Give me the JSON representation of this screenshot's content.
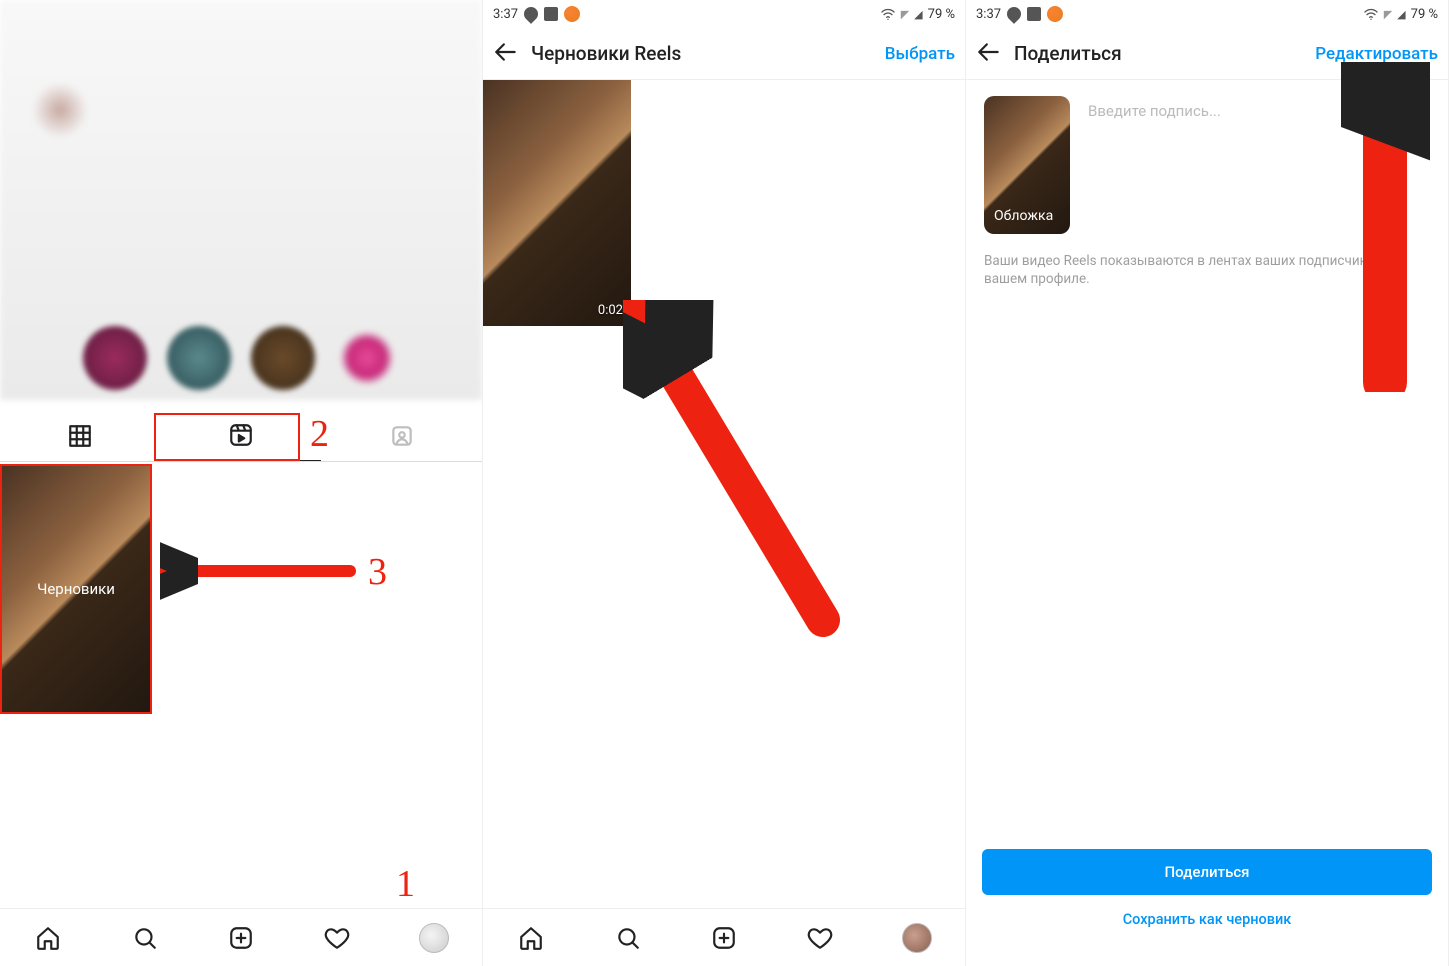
{
  "pane1": {
    "drafts_label": "Черновики",
    "annotations": {
      "num1": "1",
      "num2": "2",
      "num3": "3"
    },
    "icons": {
      "grid": "grid-icon",
      "reels": "reels-icon",
      "tagged": "tagged-icon"
    }
  },
  "pane2": {
    "status": {
      "time": "3:37",
      "battery": "79 %"
    },
    "header": {
      "title": "Черновики Reels",
      "action": "Выбрать"
    },
    "draft": {
      "duration": "0:02"
    }
  },
  "pane3": {
    "status": {
      "time": "3:37",
      "battery": "79 %"
    },
    "header": {
      "title": "Поделиться",
      "action": "Редактировать"
    },
    "cover_label": "Обложка",
    "caption_placeholder": "Введите подпись...",
    "info_text": "Ваши видео Reels показываются в лентах ваших подписчиков и в вашем профиле.",
    "footer": {
      "share_button": "Поделиться",
      "save_draft": "Сохранить как черновик"
    }
  },
  "nav": {
    "home": "home-icon",
    "search": "search-icon",
    "create": "plus-square-icon",
    "activity": "heart-icon",
    "profile": "profile-avatar-icon"
  }
}
